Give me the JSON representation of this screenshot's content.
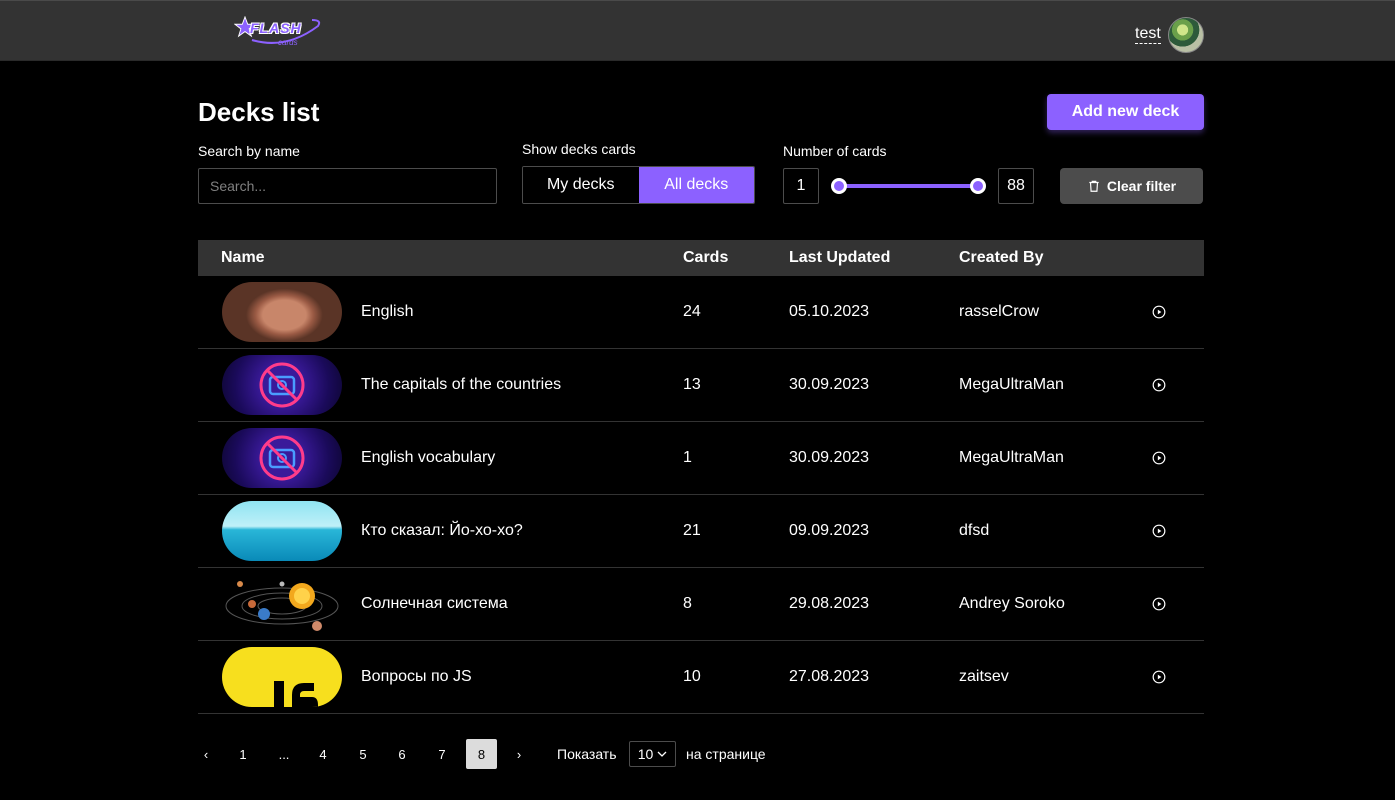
{
  "header": {
    "logo_text": "FLASH",
    "logo_subtext": "cards",
    "username": "test"
  },
  "page": {
    "title": "Decks list",
    "add_button": "Add new deck"
  },
  "filters": {
    "search_label": "Search by name",
    "search_placeholder": "Search...",
    "show_label": "Show decks cards",
    "my_decks": "My decks",
    "all_decks": "All decks",
    "selected": "All decks",
    "cards_label": "Number of cards",
    "min": "1",
    "max": "88",
    "clear_button": "Clear filter"
  },
  "table": {
    "columns": [
      "Name",
      "Cards",
      "Last Updated",
      "Created By"
    ],
    "rows": [
      {
        "name": "English",
        "cards": "24",
        "updated": "05.10.2023",
        "author": "rasselCrow",
        "cover": "photo-portrait"
      },
      {
        "name": "The capitals of the countries",
        "cards": "13",
        "updated": "30.09.2023",
        "author": "MegaUltraMan",
        "cover": "no-image-placeholder"
      },
      {
        "name": "English vocabulary",
        "cards": "1",
        "updated": "30.09.2023",
        "author": "MegaUltraMan",
        "cover": "no-image-placeholder"
      },
      {
        "name": "Кто сказал: Йо-хо-хо?",
        "cards": "21",
        "updated": "09.09.2023",
        "author": "dfsd",
        "cover": "sea"
      },
      {
        "name": "Солнечная система",
        "cards": "8",
        "updated": "29.08.2023",
        "author": "Andrey Soroko",
        "cover": "solar-system"
      },
      {
        "name": "Вопросы по JS",
        "cards": "10",
        "updated": "27.08.2023",
        "author": "zaitsev",
        "cover": "js-logo"
      }
    ]
  },
  "pagination": {
    "prev": "‹",
    "pages": [
      "1",
      "...",
      "4",
      "5",
      "6",
      "7",
      "8"
    ],
    "current": "8",
    "next": "›",
    "show_label": "Показать",
    "per_page": "10",
    "per_page_suffix": "на странице"
  },
  "colors": {
    "accent": "#8c61ff",
    "header_bg": "#333333",
    "background": "#000000"
  }
}
